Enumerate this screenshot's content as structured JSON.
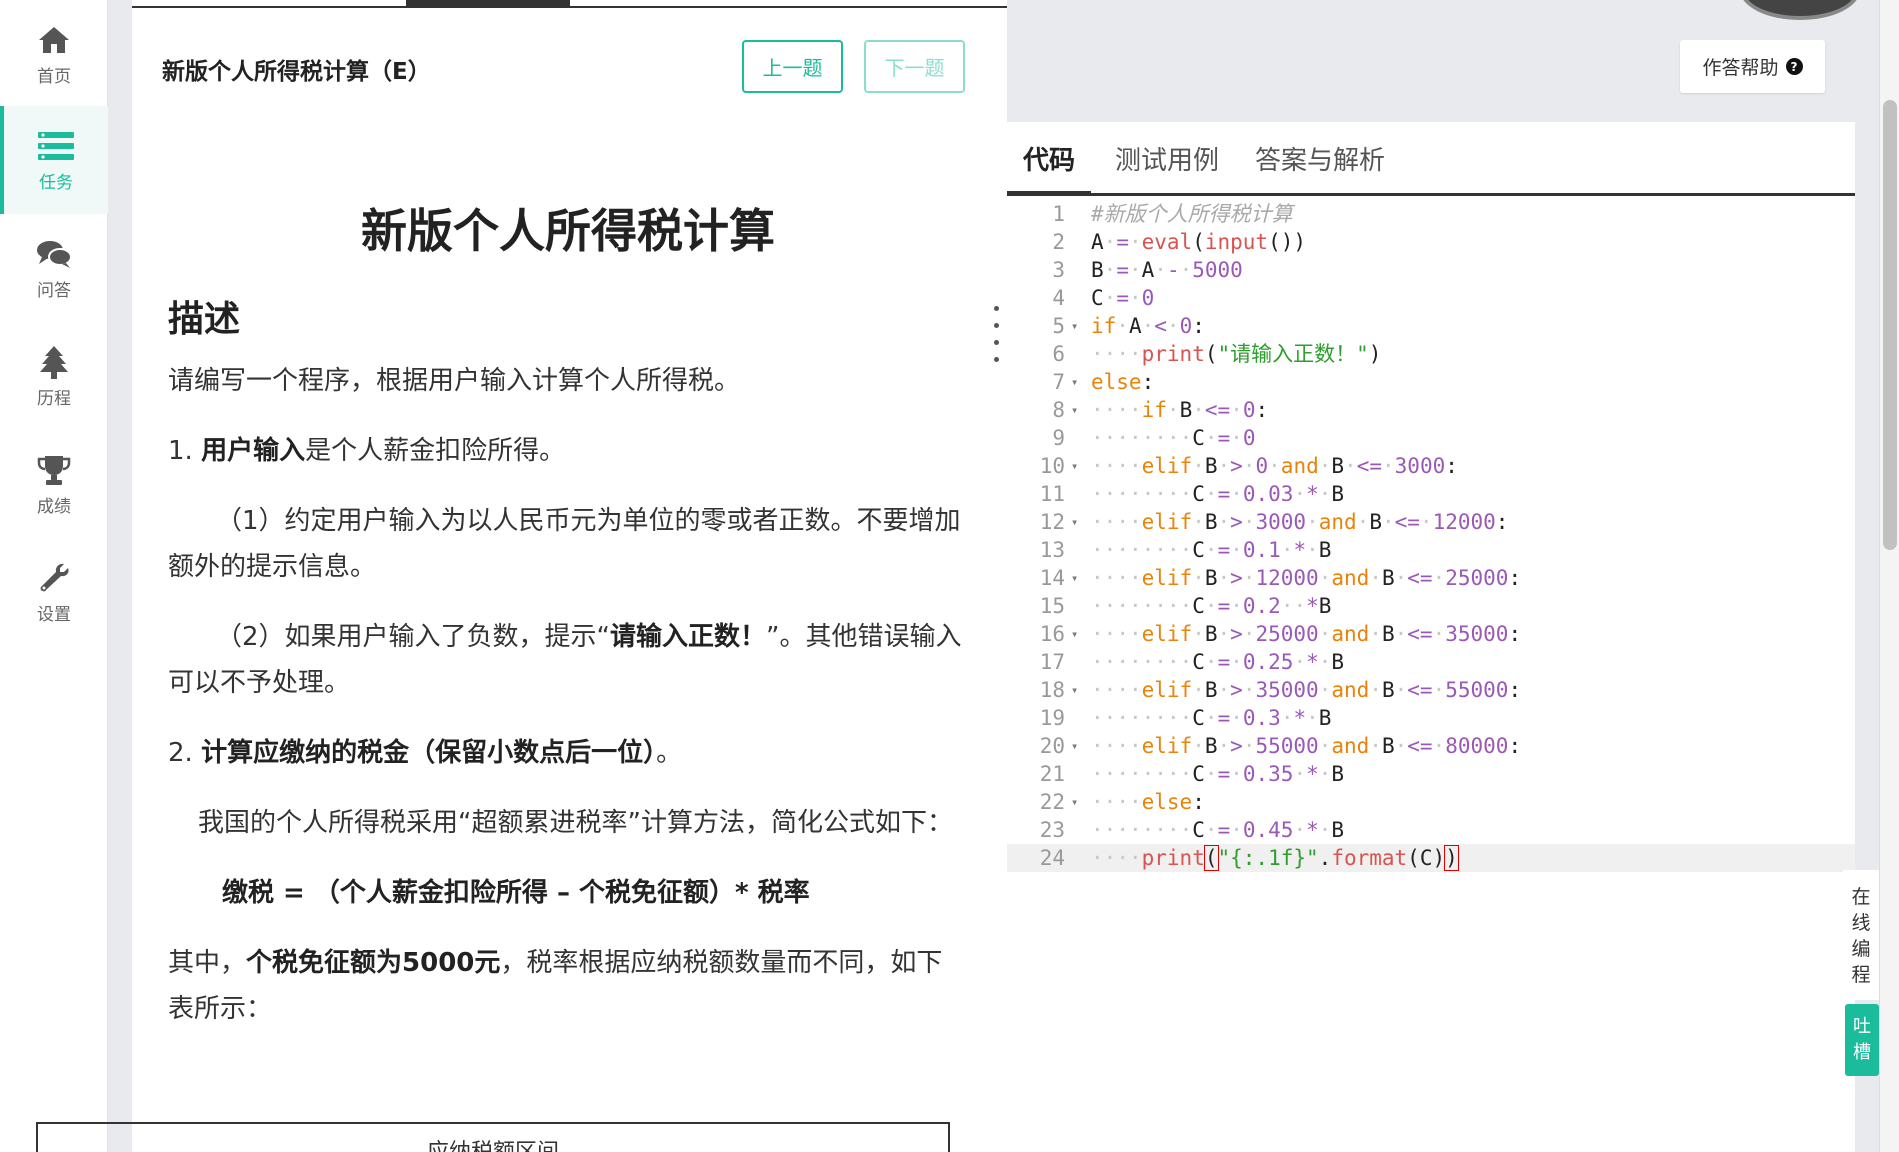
{
  "sidebar": {
    "items": [
      {
        "label": "首页",
        "icon": "home-icon"
      },
      {
        "label": "任务",
        "icon": "tasks-icon",
        "active": true
      },
      {
        "label": "问答",
        "icon": "chat-icon"
      },
      {
        "label": "历程",
        "icon": "tree-icon"
      },
      {
        "label": "成绩",
        "icon": "trophy-icon"
      },
      {
        "label": "设置",
        "icon": "wrench-icon"
      }
    ]
  },
  "problem": {
    "header_title": "新版个人所得税计算（E）",
    "prev_label": "上一题",
    "next_label": "下一题",
    "title": "新版个人所得税计算",
    "desc_heading": "描述",
    "intro": "请编写一个程序，根据用户输入计算个人所得税。",
    "point1_num": "1.",
    "point1_bold": "用户输入",
    "point1_rest": "是个人薪金扣险所得。",
    "sub1": "（1）约定用户输入为以人民币元为单位的零或者正数。不要增加额外的提示信息。",
    "sub2_a": "（2）如果用户输入了负数，提示“",
    "sub2_bold": "请输入正数！",
    "sub2_b": "”。其他错误输入可以不予处理。",
    "point2_num": "2.",
    "point2_bold": "计算应缴纳的税金（保留小数点后一位）",
    "point2_end": "。",
    "method": "我国的个人所得税采用“超额累进税率”计算方法，简化公式如下：",
    "formula": "缴税 = （个人薪金扣险所得 – 个税免征额）* 税率",
    "where_a": "其中，",
    "where_bold": "个税免征额为5000元",
    "where_b": "，税率根据应纳税额数量而不同，如下表所示：",
    "table_header": "应纳税额区间"
  },
  "editor": {
    "help_label": "作答帮助",
    "tabs": [
      "代码",
      "测试用例",
      "答案与解析"
    ],
    "active_tab": 0,
    "lines": [
      "#新版个人所得税计算",
      "A = eval(input())",
      "B = A - 5000",
      "C = 0",
      "if A < 0:",
      "    print(\"请输入正数！\")",
      "else:",
      "    if B <= 0:",
      "        C = 0",
      "    elif B > 0 and B <= 3000:",
      "        C = 0.03 * B",
      "    elif B > 3000 and B <= 12000:",
      "        C = 0.1 * B",
      "    elif B > 12000 and B <= 25000:",
      "        C = 0.2  *B",
      "    elif B > 25000 and B <= 35000:",
      "        C = 0.25 * B",
      "    elif B > 35000 and B <= 55000:",
      "        C = 0.3 * B",
      "    elif B > 55000 and B <= 80000:",
      "        C = 0.35 * B",
      "    else:",
      "        C = 0.45 * B",
      "    print(\"{:.1f}\".format(C))"
    ],
    "fold_lines": [
      5,
      7,
      8,
      10,
      12,
      14,
      16,
      18,
      20,
      22
    ],
    "current_line": 24
  },
  "side": {
    "online_label": "在线编程",
    "feedback_label": "吐槽"
  },
  "colors": {
    "accent": "#1abc9c",
    "keyword": "#e9830b",
    "number": "#9b59b6",
    "string": "#2e9e2e",
    "builtin": "#d9534f"
  }
}
